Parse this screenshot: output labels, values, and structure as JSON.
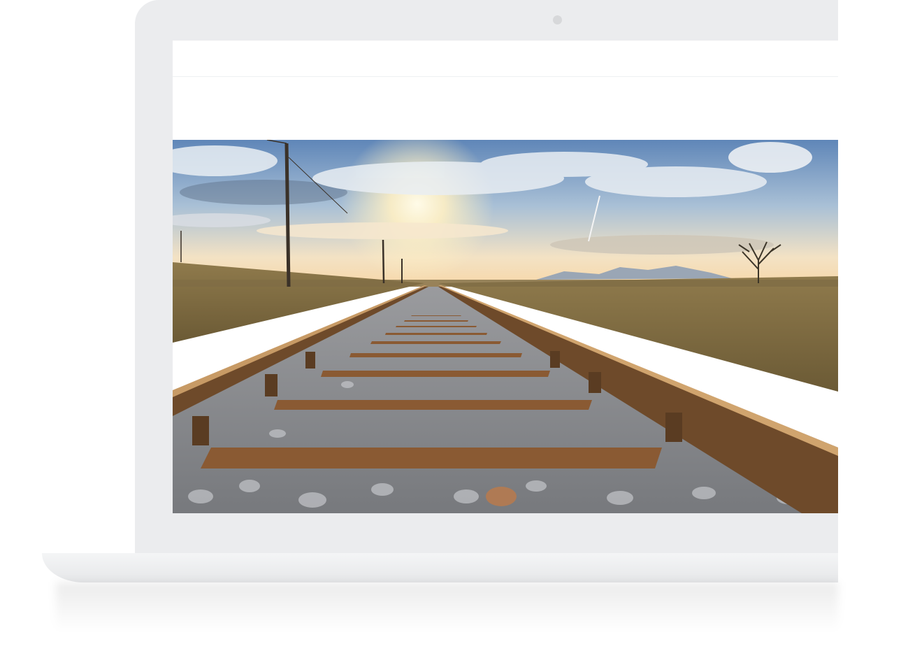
{
  "device": {
    "frame_color": "#ebecee",
    "screen_color": "#ffffff"
  },
  "website": {
    "header": {},
    "hero": {
      "image_description_icon": "railway-tracks-sunset-photo",
      "sky_top": "#5f86b8",
      "sun": "#fff6d6",
      "rust": "#8a5a33",
      "grass": "#8c7648",
      "gravel": "#a6a8ad"
    }
  }
}
